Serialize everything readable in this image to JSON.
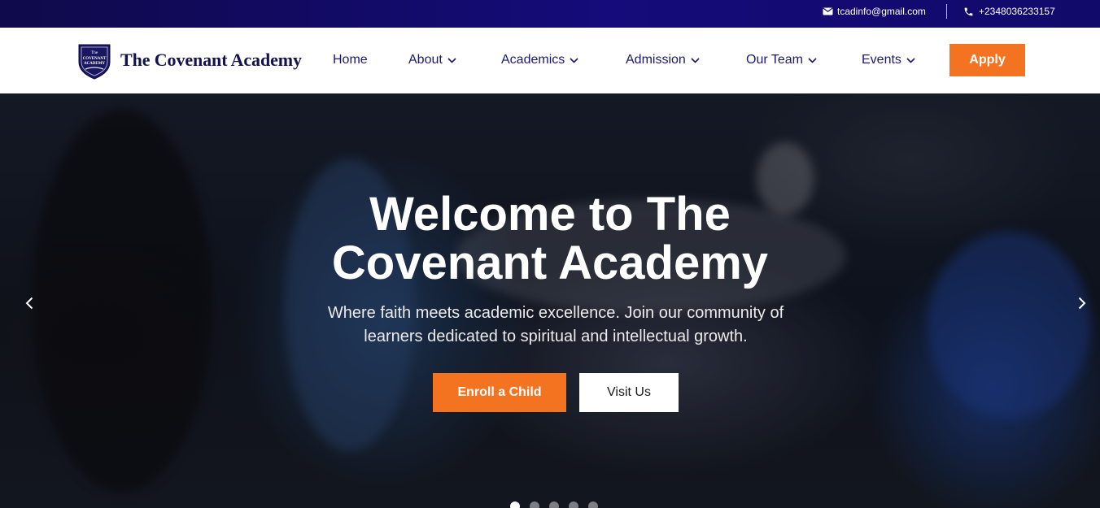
{
  "topbar": {
    "email": "tcadinfo@gmail.com",
    "phone": "+2348036233157",
    "email_icon": "envelope-icon",
    "phone_icon": "phone-icon"
  },
  "brand": {
    "name": "The Covenant Academy",
    "crest_top": "The",
    "crest_mid": "COVENANT",
    "crest_bot": "ACADEMY"
  },
  "nav": {
    "items": [
      {
        "label": "Home"
      },
      {
        "label": "About"
      },
      {
        "label": "Academics"
      },
      {
        "label": "Admission"
      },
      {
        "label": "Our Team"
      },
      {
        "label": "Events"
      }
    ],
    "apply_label": "Apply"
  },
  "hero": {
    "title_line1": "Welcome to The",
    "title_line2": "Covenant Academy",
    "subtitle": "Where faith meets academic excellence. Join our community of learners dedicated to spiritual and intellectual growth.",
    "enroll_label": "Enroll a Child",
    "visit_label": "Visit Us",
    "slide_count": 5,
    "active_slide": 1
  },
  "colors": {
    "accent": "#f47321",
    "navy": "#1b1870",
    "topbar": "#150b7a"
  }
}
